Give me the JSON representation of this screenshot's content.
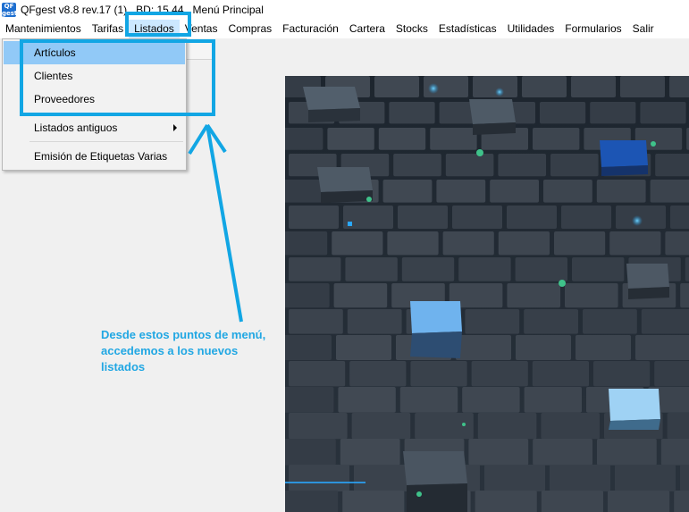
{
  "window": {
    "title": "QFgest v8.8 rev.17 (1)   BD: 15.44   Menú Principal",
    "app_icon_text": "QF gest"
  },
  "menubar": {
    "items": [
      {
        "label": "Mantenimientos"
      },
      {
        "label": "Tarifas"
      },
      {
        "label": "Listados"
      },
      {
        "label": "Ventas"
      },
      {
        "label": "Compras"
      },
      {
        "label": "Facturación"
      },
      {
        "label": "Cartera"
      },
      {
        "label": "Stocks"
      },
      {
        "label": "Estadísticas"
      },
      {
        "label": "Utilidades"
      },
      {
        "label": "Formularios"
      },
      {
        "label": "Salir"
      }
    ],
    "open_menu": "Listados"
  },
  "dropdown": {
    "items": [
      {
        "label": "Artículos",
        "highlighted": true
      },
      {
        "label": "Clientes"
      },
      {
        "label": "Proveedores"
      },
      {
        "label": "Listados antiguos",
        "has_submenu": true
      },
      {
        "label": "Emisión de Etiquetas Varias"
      }
    ]
  },
  "annotation": {
    "text": "Desde estos puntos de menú, accedemos a los nuevos listados",
    "color": "#21a7e3"
  },
  "colors": {
    "highlight_border": "#12a6e4",
    "menu_hover": "#91c9f7",
    "background_tiles": "#3b4653"
  }
}
